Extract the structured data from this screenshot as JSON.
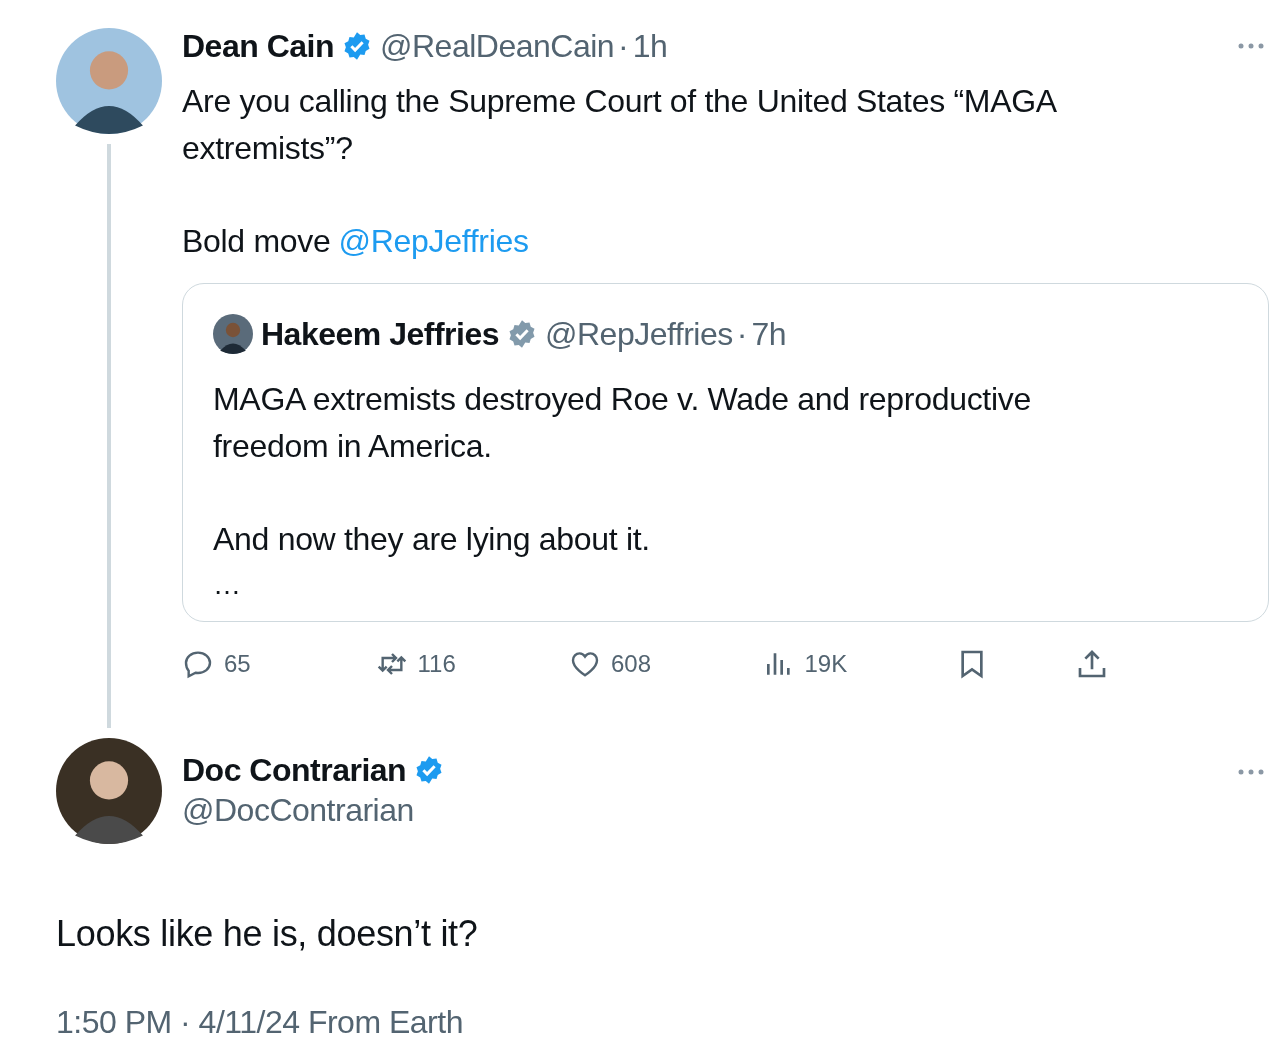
{
  "thread": {
    "name": "Dean Cain",
    "verified": true,
    "color": "#1d9bf0",
    "handle": "@RealDeanCain",
    "separator": "·",
    "time": "1h",
    "paragraphs": [
      {
        "text": "Are you calling the Supreme Court of the United States “MAGA extremists”?"
      },
      {
        "text": "Bold move",
        "link": "@RepJeffries"
      }
    ],
    "quote": {
      "name": "Hakeem Jeffries",
      "verified": true,
      "color": "#829aab",
      "handle": "@RepJeffries",
      "separator": "·",
      "time": "7h",
      "paragraphs": [
        {
          "text": "MAGA extremists destroyed Roe v. Wade and reproductive freedom in America."
        },
        {
          "text": "And now they are lying about it."
        }
      ],
      "ellipsis": "…"
    },
    "actions": [
      {
        "kind": "reply",
        "count": "65"
      },
      {
        "kind": "repost",
        "count": "116"
      },
      {
        "kind": "like",
        "count": "608"
      },
      {
        "kind": "views",
        "count": "19K"
      },
      {
        "kind": "bookmark"
      },
      {
        "kind": "share"
      }
    ]
  },
  "reply": {
    "name": "Doc Contrarian",
    "verified": true,
    "color": "#1d9bf0",
    "handle": "@DocContrarian",
    "text": "Looks like he is, doesn’t it?",
    "meta": "1:50 PM · 4/11/24 From Earth"
  }
}
